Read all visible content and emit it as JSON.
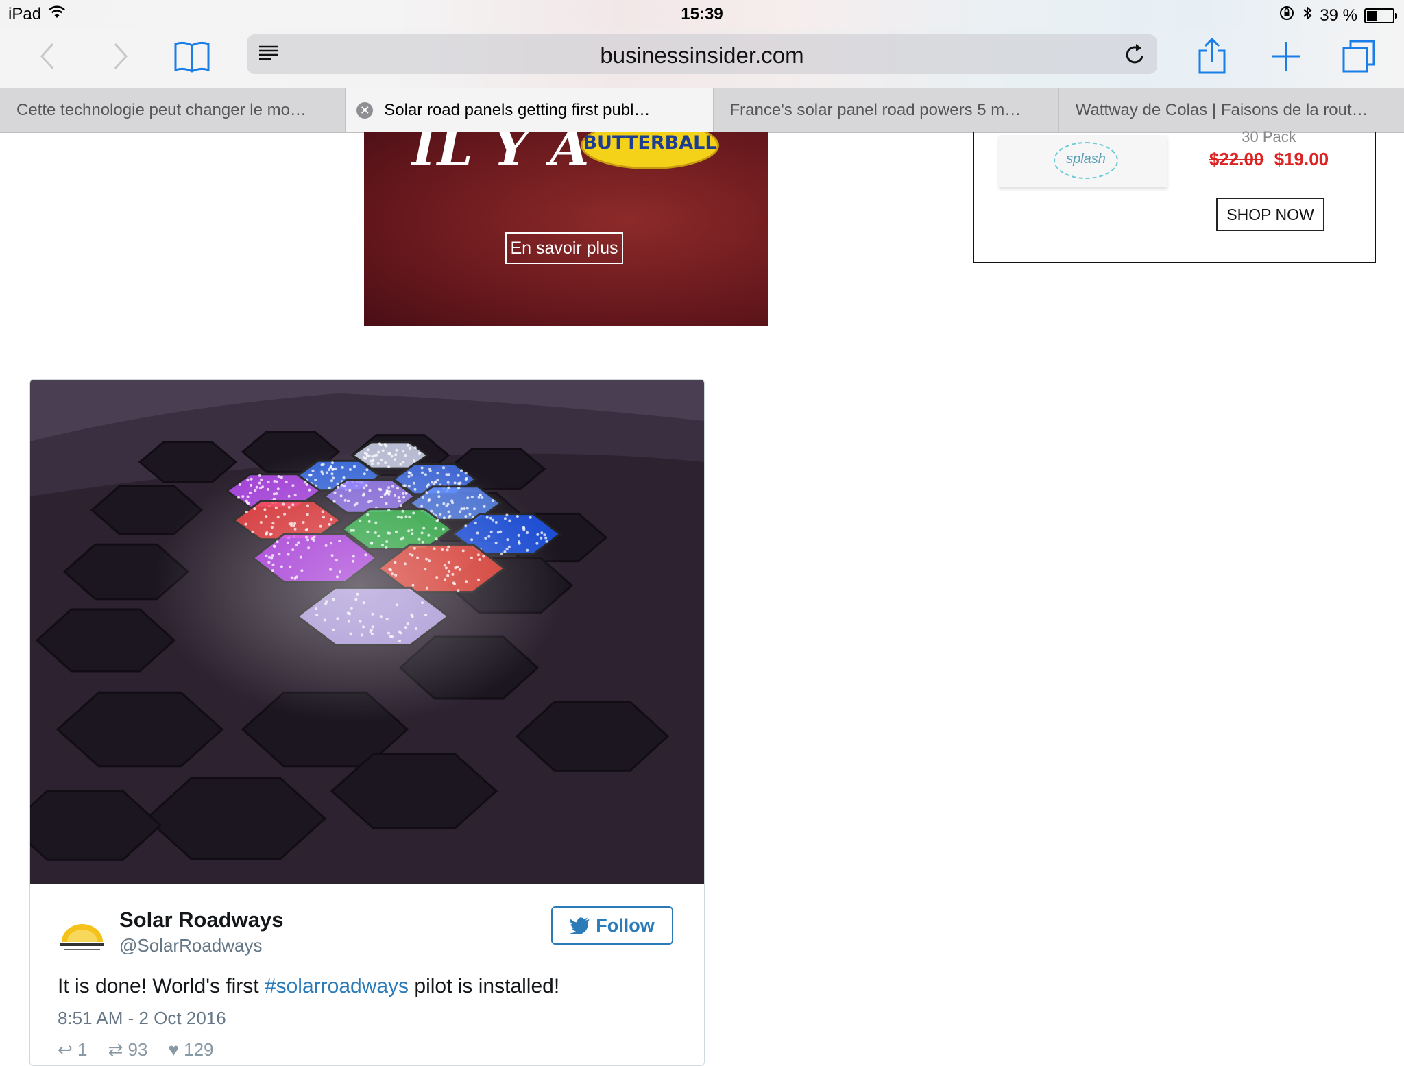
{
  "status_bar": {
    "device": "iPad",
    "time": "15:39",
    "battery": "39 %",
    "battery_level": 0.39
  },
  "toolbar": {
    "url": "businessinsider.com",
    "icons": [
      "back-icon",
      "forward-icon",
      "bookmarks-icon",
      "reader-icon",
      "reload-icon",
      "share-icon",
      "new-tab-icon",
      "tabs-icon"
    ]
  },
  "tabs": [
    {
      "title": "Cette technologie peut changer le mo…",
      "active": false
    },
    {
      "title": "Solar road panels getting first publ…",
      "active": true
    },
    {
      "title": "France's solar panel road powers 5 m…",
      "active": false
    },
    {
      "title": "Wattway de Colas | Faisons de la rout…",
      "active": false
    }
  ],
  "ads": {
    "butterball": {
      "headline": "IL Y A",
      "brand": "BUTTERBALL",
      "cta": "En savoir plus"
    },
    "splash": {
      "logo": "splash",
      "pack": "30 Pack",
      "old_price": "$22.00",
      "new_price": "$19.00",
      "cta": "SHOP NOW",
      "price_color": "#dd2222"
    }
  },
  "tweet": {
    "author_name": "Solar Roadways",
    "author_handle": "@SolarRoadways",
    "follow_label": "Follow",
    "text_before": "It is done! World's first ",
    "hashtag": "#solarroadways",
    "text_after": " pilot is installed!",
    "date": "8:51 AM - 2 Oct 2016",
    "reply_count": "1",
    "retweet_count": "93",
    "like_count": "129",
    "accent_color": "#2b7bb9"
  }
}
